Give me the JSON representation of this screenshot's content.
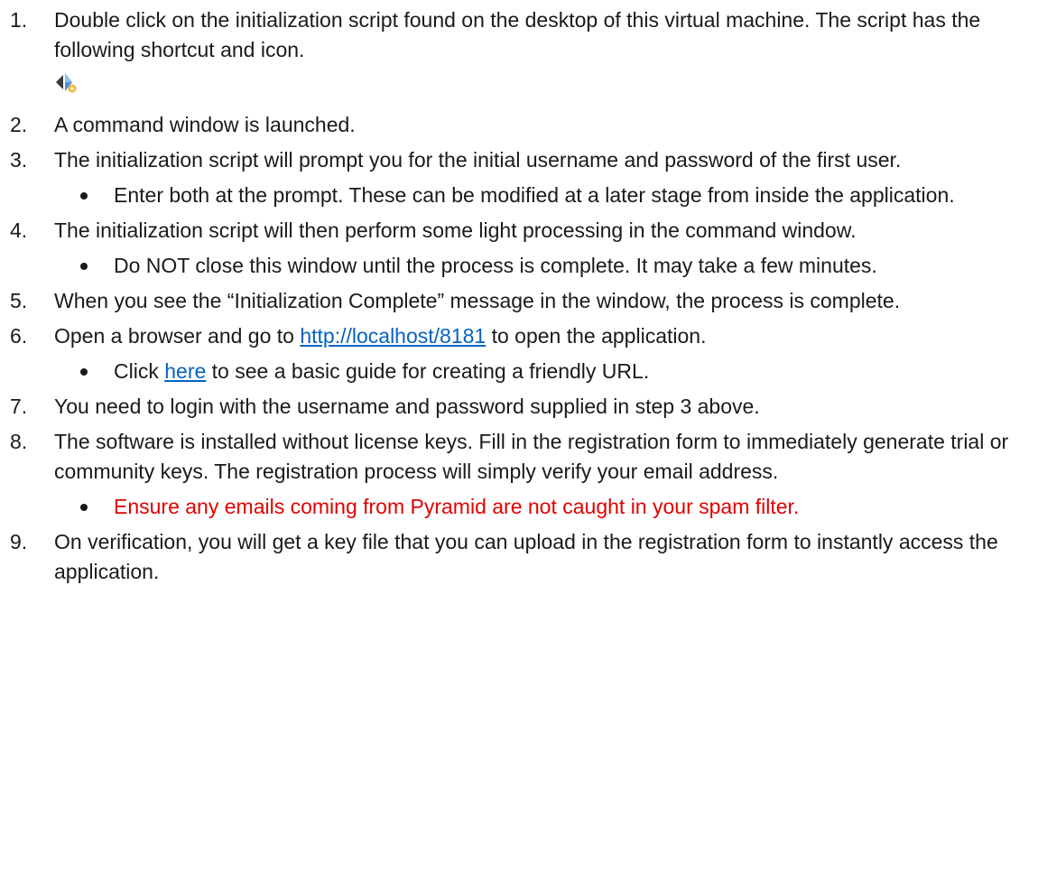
{
  "steps": [
    {
      "num": "1.",
      "text": "Double click on the initialization script found on the desktop of this virtual machine. The script has the following shortcut and icon.",
      "icon": "pyramid-script-icon"
    },
    {
      "num": "2.",
      "text": "A command window is launched."
    },
    {
      "num": "3.",
      "text": "The initialization script will prompt you for the initial username and password of the first user.",
      "bullets": [
        "Enter both at the prompt. These can be modified at a later stage from inside the application."
      ]
    },
    {
      "num": "4.",
      "text": "The initialization script will then perform some light processing in the command window.",
      "bullets": [
        "Do NOT close this window until the process is complete. It may take a few minutes."
      ]
    },
    {
      "num": "5.",
      "text": "When you see the “Initialization Complete” message in the window, the process is complete."
    },
    {
      "num": "6.",
      "pre": "Open a browser and go to ",
      "link": "http://localhost/8181",
      "post": " to open the application.",
      "bullet_pre": "Click ",
      "bullet_link": "here",
      "bullet_post": " to see a basic guide for creating a friendly URL."
    },
    {
      "num": "7.",
      "text": "You need to login with the username and password supplied in step 3 above."
    },
    {
      "num": "8.",
      "text": "The software is installed without license keys. Fill in the registration form to immediately generate trial or community keys. The registration process will simply verify your email address.",
      "bullets": [
        "Ensure any emails coming from Pyramid are not caught in your spam filter."
      ]
    },
    {
      "num": "9.",
      "text": "On verification, you will get a key file that you can upload in the registration form to instantly access the application."
    }
  ],
  "colors": {
    "text": "#1a1a1a",
    "link": "#0563c1",
    "warning": "#e00000"
  }
}
